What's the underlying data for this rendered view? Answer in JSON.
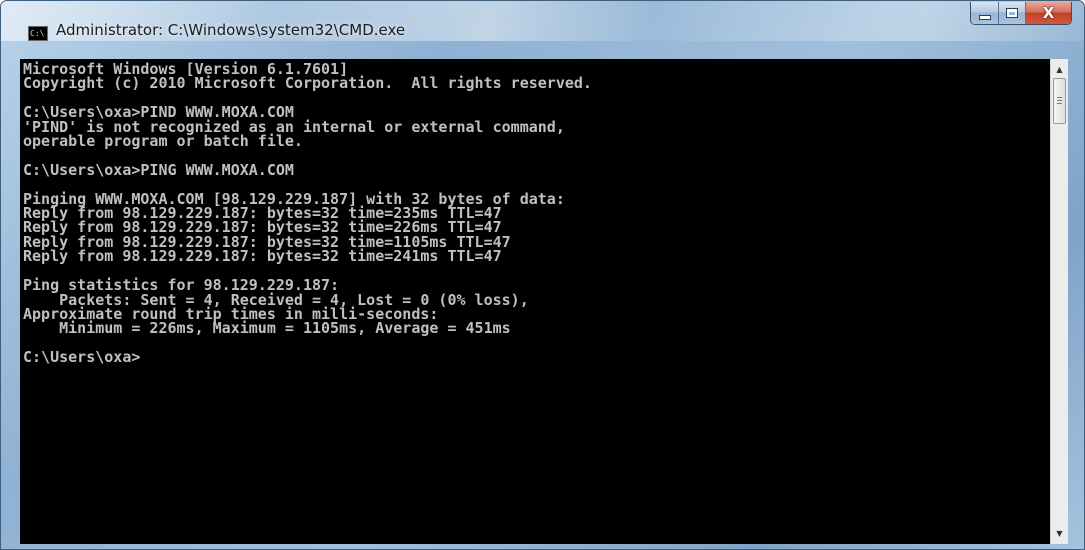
{
  "window": {
    "title": "Administrator: C:\\Windows\\system32\\CMD.exe",
    "app_icon_text": "C:\\"
  },
  "caption_buttons": {
    "close_label": "X"
  },
  "console": {
    "text": "Microsoft Windows [Version 6.1.7601]\nCopyright (c) 2010 Microsoft Corporation.  All rights reserved.\n\nC:\\Users\\oxa>PIND WWW.MOXA.COM\n'PIND' is not recognized as an internal or external command,\noperable program or batch file.\n\nC:\\Users\\oxa>PING WWW.MOXA.COM\n\nPinging WWW.MOXA.COM [98.129.229.187] with 32 bytes of data:\nReply from 98.129.229.187: bytes=32 time=235ms TTL=47\nReply from 98.129.229.187: bytes=32 time=226ms TTL=47\nReply from 98.129.229.187: bytes=32 time=1105ms TTL=47\nReply from 98.129.229.187: bytes=32 time=241ms TTL=47\n\nPing statistics for 98.129.229.187:\n    Packets: Sent = 4, Received = 4, Lost = 0 (0% loss),\nApproximate round trip times in milli-seconds:\n    Minimum = 226ms, Maximum = 1105ms, Average = 451ms\n\nC:\\Users\\oxa>",
    "background": "#000000",
    "foreground": "#c0c0c0"
  },
  "scrollbar": {
    "up_icon": "triangle-up-icon",
    "down_icon": "triangle-down-icon"
  }
}
